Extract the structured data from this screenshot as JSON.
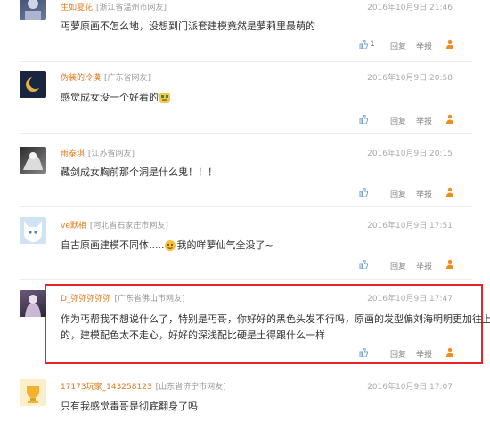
{
  "labels": {
    "reply": "回复",
    "report": "举报"
  },
  "colors": {
    "username": "#e07a1f",
    "highlight": "#e3242b"
  },
  "comments": [
    {
      "username": "生如夏花",
      "location": "[浙江省温州市网友]",
      "time": "2016年10月9日 21:46",
      "text": "丐萝原画不怎么地，没想到门派套建模竟然是萝莉里最萌的",
      "likes": "1"
    },
    {
      "username": "伪装的冷漠",
      "location": "[广东省网友]",
      "time": "2016年10月9日 20:58",
      "text": "感觉成女没一个好看的",
      "emoji_icon": "doge-emoji-icon"
    },
    {
      "username": "雨泰琪",
      "location": "[江苏省网友]",
      "time": "2016年10月9日 20:15",
      "text": "藏剑成女胸前那个洞是什么鬼！！！"
    },
    {
      "username": "ve默相",
      "location": "[河北省石家庄市网友]",
      "time": "2016年10月9日 17:51",
      "text_before": "自古原画建模不同体.....",
      "text_after": "我的咩萝仙气全没了~",
      "emoji_icon": "face-emoji-icon"
    },
    {
      "username": "D_弥弥弥弥弥",
      "location": "[广东省佛山市网友]",
      "time": "2016年10月9日 17:47",
      "line1": "作为丐帮我不想说什么了，特别是丐哥，你好好的黑色头发不行吗，原画的发型偏刘海明明更加往上",
      "line2": "的，建模配色太不走心，好好的深浅配比硬是土得跟什么一样",
      "highlighted": true
    },
    {
      "username": "17173玩家_143258123",
      "location": "[山东省济宁市网友]",
      "time": "2016年10月9日 17:07",
      "text": "只有我感觉毒哥是彻底翻身了吗"
    }
  ]
}
